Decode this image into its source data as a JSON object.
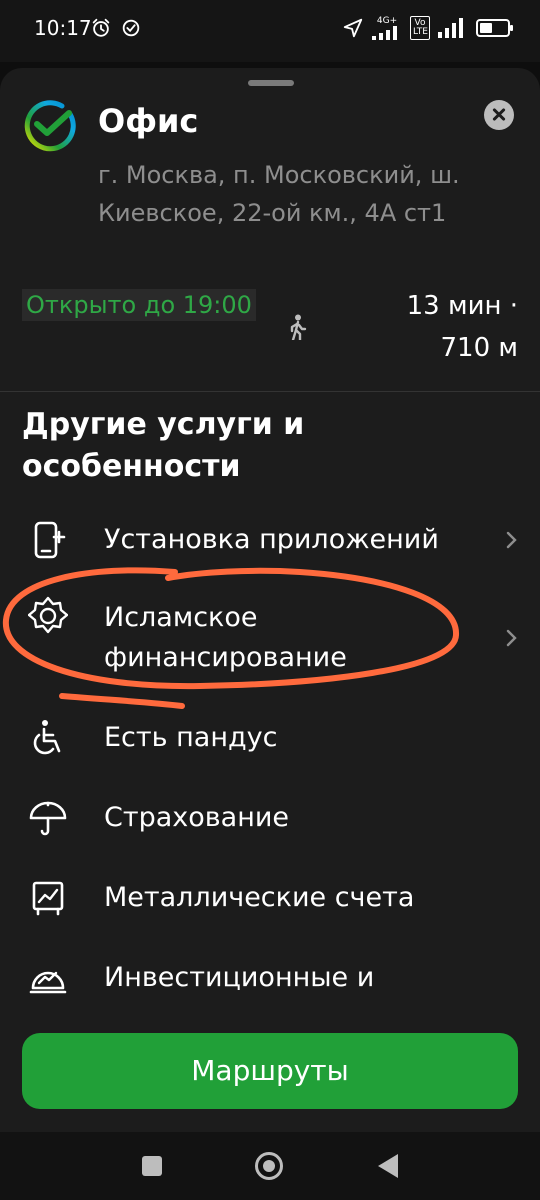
{
  "status_bar": {
    "time": "10:17",
    "network_tag": "4G+",
    "volte_tag": "Vo LTE",
    "battery_level": 0.45,
    "icons": [
      "alarm-icon",
      "check-circle-icon",
      "location-arrow-icon",
      "signal-icon",
      "signal-icon",
      "battery-icon"
    ]
  },
  "place": {
    "title": "Офис",
    "address": "г. Москва, п. Московский, ш. Киевское, 22-ой км., 4А ст1",
    "open_status": "Открыто до 19:00",
    "walk_time": "13 мин ·",
    "walk_distance": "710 м"
  },
  "services": {
    "title": "Другие услуги и особенности",
    "items": [
      {
        "label": "Установка приложений",
        "icon": "phone-plus-icon",
        "has_chevron": true
      },
      {
        "label": "Исламское финансирование",
        "icon": "star-badge-icon",
        "has_chevron": true
      },
      {
        "label": "Есть пандус",
        "icon": "wheelchair-icon",
        "has_chevron": false
      },
      {
        "label": "Страхование",
        "icon": "umbrella-icon",
        "has_chevron": false
      },
      {
        "label": "Металлические счета",
        "icon": "chart-board-icon",
        "has_chevron": false
      },
      {
        "label": "Инвестиционные и",
        "icon": "gauge-icon",
        "has_chevron": false
      }
    ]
  },
  "actions": {
    "routes_label": "Маршруты"
  },
  "colors": {
    "accent_green": "#21a038",
    "open_green": "#2fa846",
    "annotation": "#ff6a3d"
  }
}
